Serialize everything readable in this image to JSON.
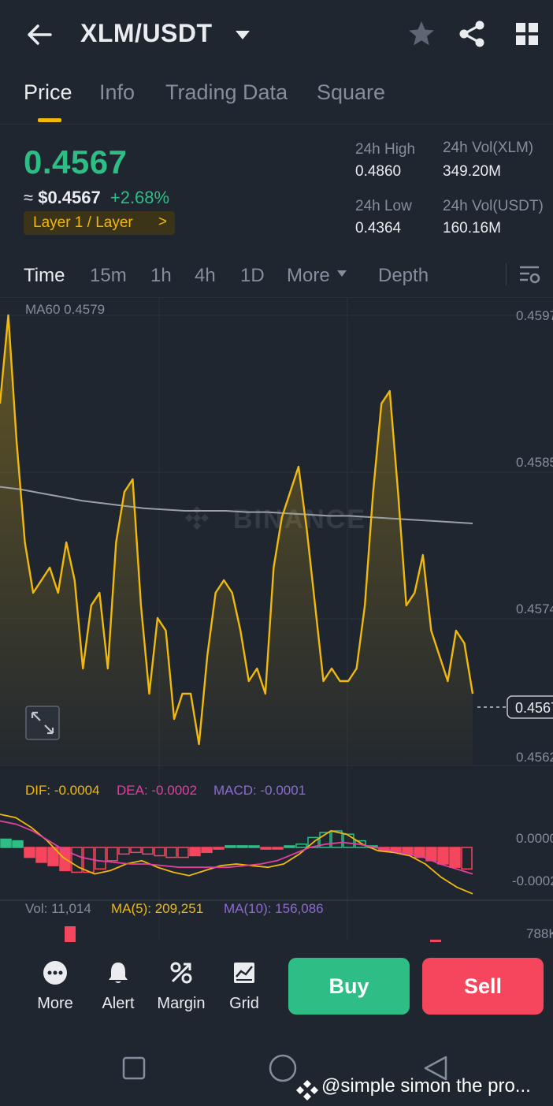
{
  "header": {
    "pair": "XLM/USDT"
  },
  "tabs": [
    {
      "label": "Price",
      "active": true
    },
    {
      "label": "Info",
      "active": false
    },
    {
      "label": "Trading Data",
      "active": false
    },
    {
      "label": "Square",
      "active": false
    }
  ],
  "ticker": {
    "price": "0.4567",
    "usd_prefix": "≈",
    "usd_value": "$0.4567",
    "change": "+2.68%",
    "tag": "Layer 1 / Layer",
    "tag_chevron": ">",
    "high_label": "24h High",
    "high_value": "0.4860",
    "low_label": "24h Low",
    "low_value": "0.4364",
    "vol_base_label": "24h Vol(XLM)",
    "vol_base_value": "349.20M",
    "vol_quote_label": "24h Vol(USDT)",
    "vol_quote_value": "160.16M"
  },
  "timeframes": [
    "Time",
    "15m",
    "1h",
    "4h",
    "1D",
    "More",
    "Depth"
  ],
  "colors": {
    "up": "#2ebd85",
    "down": "#f6465d",
    "accent": "#f0b90b",
    "bg": "#1f2630",
    "muted": "#848e9c",
    "ma": "#9aa0a6",
    "dea": "#e040a0",
    "macd": "#8e6bd1"
  },
  "chart_data": {
    "type": "line",
    "watermark": "BINANCE",
    "price_panel": {
      "ma_label": "MA60 0.4579",
      "y_ticks": [
        "0.4597",
        "0.4585",
        "0.4574",
        "0.4562"
      ],
      "last_price_label": "0.4567",
      "ylim": [
        0.4562,
        0.4597
      ],
      "series": [
        {
          "name": "price",
          "values": [
            0.459,
            0.4597,
            0.4587,
            0.4579,
            0.4575,
            0.4576,
            0.4577,
            0.4575,
            0.4579,
            0.4576,
            0.4569,
            0.4574,
            0.4575,
            0.4569,
            0.4579,
            0.4583,
            0.4584,
            0.4574,
            0.4567,
            0.4573,
            0.4572,
            0.4565,
            0.4567,
            0.4567,
            0.4563,
            0.457,
            0.4575,
            0.4576,
            0.4575,
            0.4572,
            0.4568,
            0.4569,
            0.4567,
            0.4577,
            0.4581,
            0.4583,
            0.4585,
            0.458,
            0.4574,
            0.4568,
            0.4569,
            0.4568,
            0.4568,
            0.4569,
            0.4574,
            0.4583,
            0.459,
            0.4591,
            0.4583,
            0.4574,
            0.4575,
            0.4578,
            0.4572,
            0.457,
            0.4568,
            0.4572,
            0.4571,
            0.4567
          ]
        },
        {
          "name": "MA60",
          "values": [
            0.45834,
            0.45832,
            0.45829,
            0.45826,
            0.45823,
            0.45821,
            0.45819,
            0.45817,
            0.45816,
            0.45815,
            0.45815,
            0.45815,
            0.45814,
            0.45814,
            0.45813,
            0.45812,
            0.45811,
            0.45811,
            0.4581,
            0.45809,
            0.45808,
            0.45807,
            0.45806,
            0.45805
          ]
        }
      ]
    },
    "macd_panel": {
      "dif_label": "DIF: -0.0004",
      "dea_label": "DEA: -0.0002",
      "macd_label": "MACD: -0.0001",
      "y_ticks": [
        "0.0000",
        "-0.0002"
      ],
      "histogram": [
        5e-05,
        4e-05,
        -6e-05,
        -9e-05,
        -0.00011,
        -0.00014,
        -0.00015,
        -0.00015,
        -0.00013,
        -8e-05,
        -4e-05,
        -3e-05,
        -4e-05,
        -5e-05,
        -6e-05,
        -6e-05,
        -5e-05,
        -3e-05,
        -1e-05,
        1e-05,
        1e-05,
        0.0,
        -1e-05,
        -1e-05,
        0.0,
        2e-05,
        6e-05,
        9e-05,
        0.0001,
        8e-05,
        4e-05,
        0.0,
        -2e-05,
        -3e-05,
        -4e-05,
        -6e-05,
        -8e-05,
        -0.0001,
        -0.00012,
        -0.00013
      ],
      "dif": [
        0.0002,
        0.00018,
        0.00012,
        4e-05,
        -6e-05,
        -0.00012,
        -0.00016,
        -0.00014,
        -0.0001,
        -8e-05,
        -0.00012,
        -0.00015,
        -0.00017,
        -0.00014,
        -0.00011,
        -0.0001,
        -0.00011,
        -0.00012,
        -0.0001,
        -4e-05,
        4e-05,
        0.0001,
        8e-05,
        2e-05,
        -2e-05,
        -3e-05,
        -5e-05,
        -0.0001,
        -0.00018,
        -0.00024,
        -0.00028
      ],
      "dea": [
        0.00016,
        0.00014,
        0.0001,
        4e-05,
        -2e-05,
        -6e-05,
        -8e-05,
        -9e-05,
        -0.0001,
        -0.0001,
        -0.00011,
        -0.00012,
        -0.00012,
        -0.00012,
        -0.00012,
        -0.00011,
        -0.0001,
        -8e-05,
        -4e-05,
        0.0,
        2e-05,
        3e-05,
        2e-05,
        0.0,
        -2e-05,
        -4e-05,
        -6e-05,
        -0.0001,
        -0.00013,
        -0.00016
      ]
    },
    "volume_panel": {
      "vol_label": "Vol: 11,014",
      "ma5_label": "MA(5): 209,251",
      "ma10_label": "MA(10): 156,086",
      "y_tick": "788K"
    }
  },
  "bottom_bar": {
    "items": [
      {
        "label": "More",
        "icon": "more-icon"
      },
      {
        "label": "Alert",
        "icon": "bell-icon"
      },
      {
        "label": "Margin",
        "icon": "percent-icon"
      },
      {
        "label": "Grid",
        "icon": "grid-chart-icon"
      }
    ],
    "buy": "Buy",
    "sell": "Sell"
  },
  "watermark_caption": "@simple simon the pro..."
}
